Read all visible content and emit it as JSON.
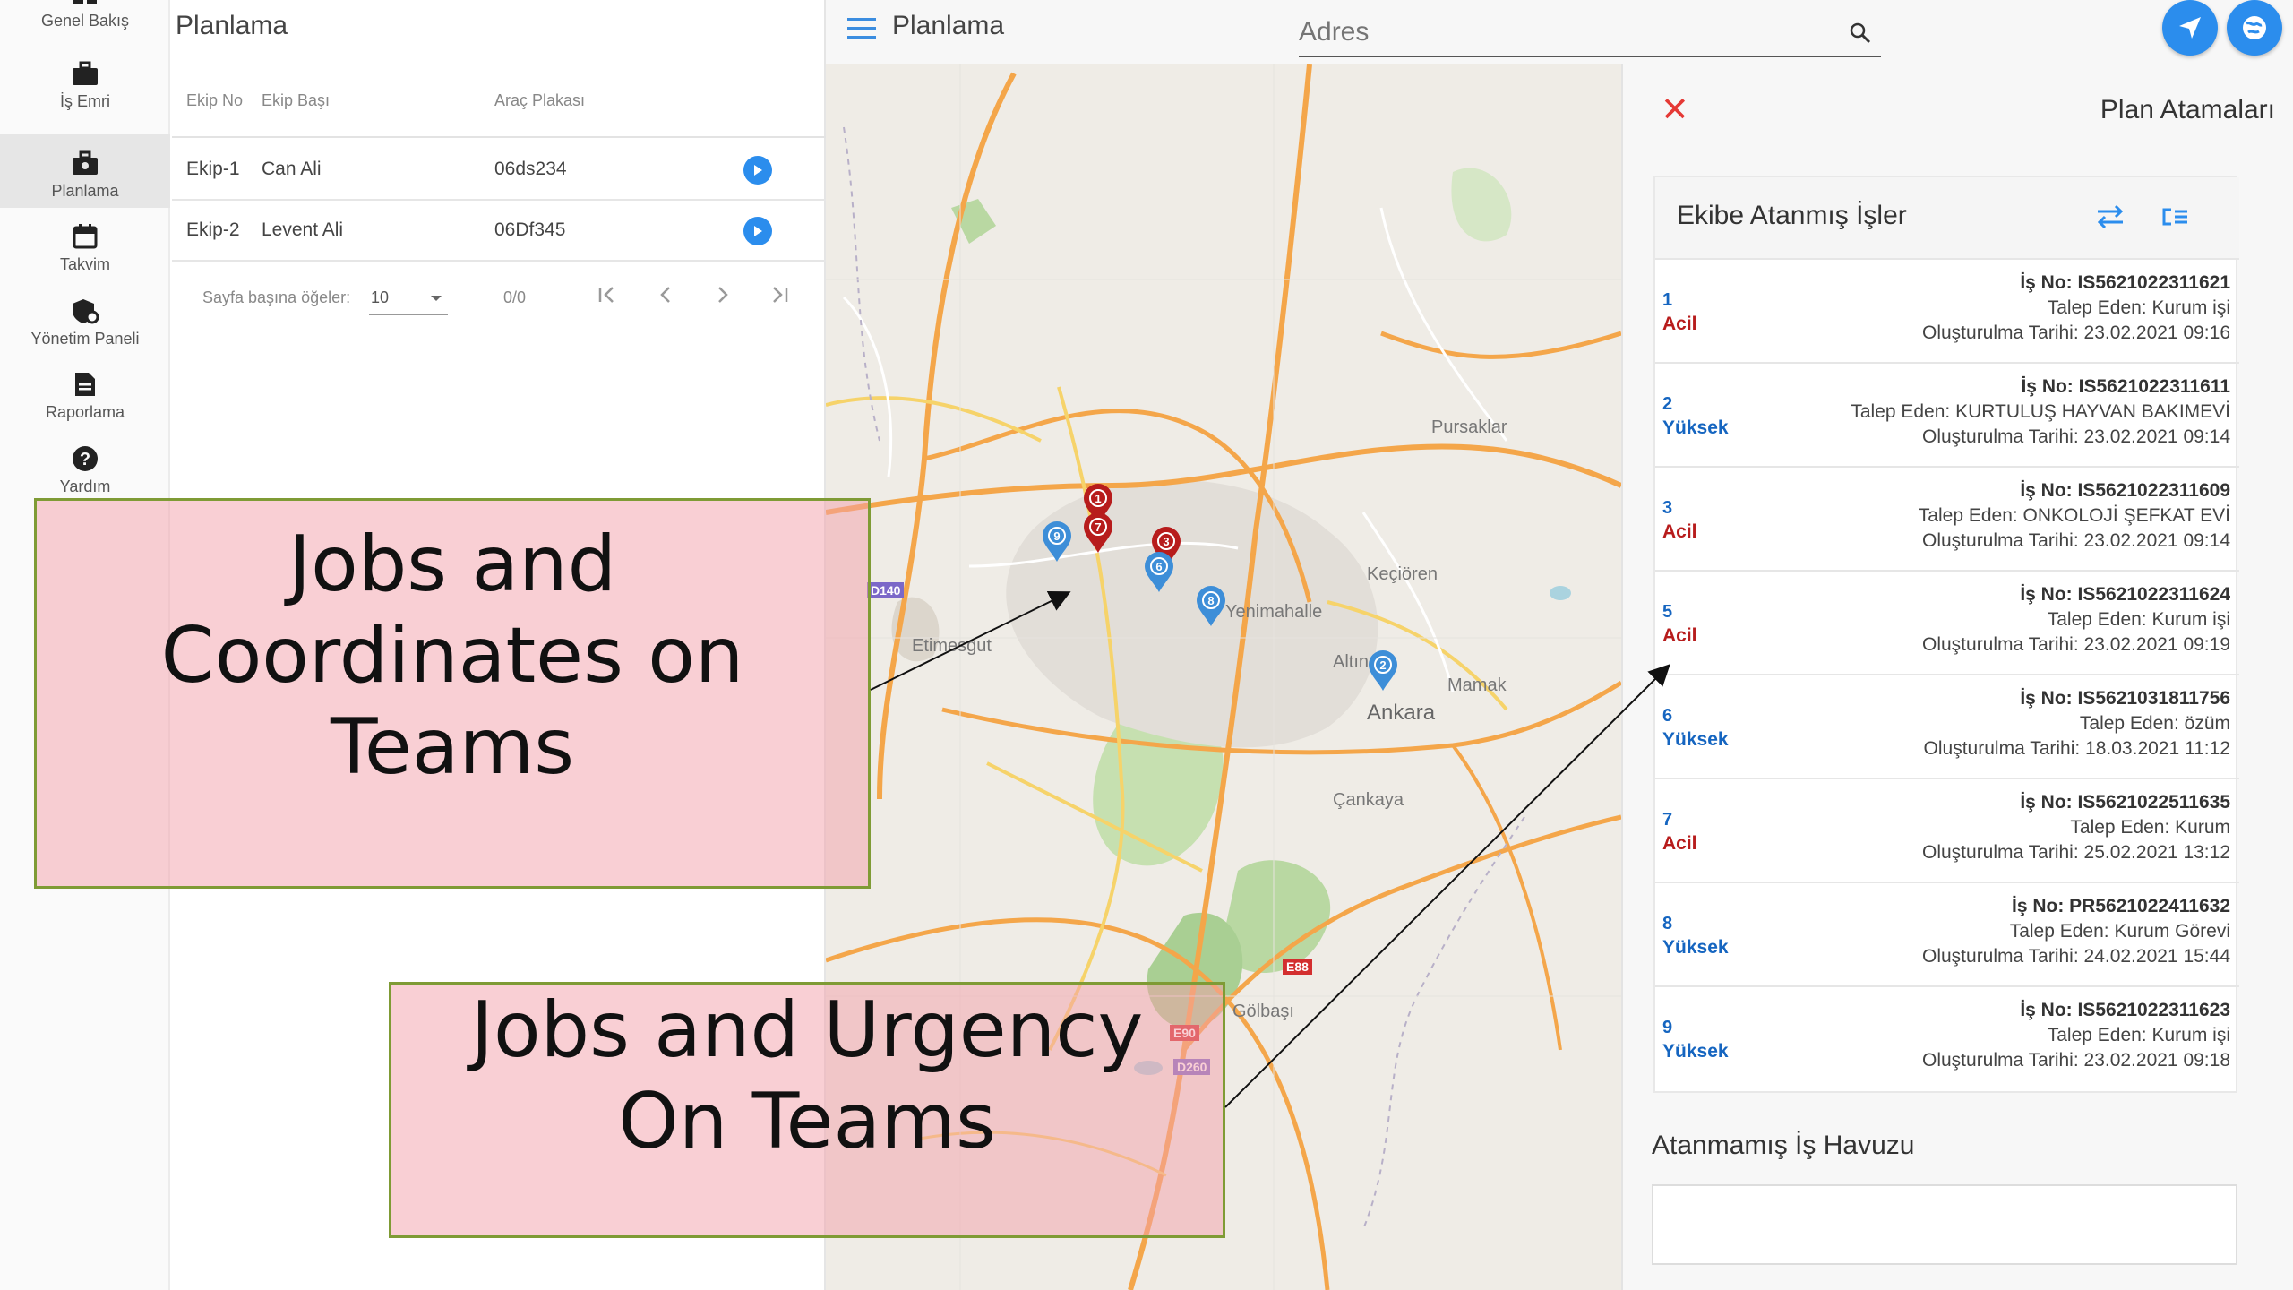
{
  "nav": {
    "items": [
      {
        "label": "Genel Bakış",
        "icon": "dashboard-icon"
      },
      {
        "label": "İş Emri",
        "icon": "briefcase-icon"
      },
      {
        "label": "Planlama",
        "icon": "planning-icon",
        "active": true
      },
      {
        "label": "Takvim",
        "icon": "calendar-icon"
      },
      {
        "label": "Yönetim Paneli",
        "icon": "admin-icon"
      },
      {
        "label": "Raporlama",
        "icon": "report-icon"
      },
      {
        "label": "Yardım",
        "icon": "help-icon"
      }
    ]
  },
  "teams": {
    "title": "Planlama",
    "columns": [
      "Ekip No",
      "Ekip Başı",
      "Araç Plakası"
    ],
    "rows": [
      {
        "no": "Ekip-1",
        "leader": "Can Ali",
        "plate": "06ds234"
      },
      {
        "no": "Ekip-2",
        "leader": "Levent Ali",
        "plate": "06Df345"
      }
    ],
    "pager": {
      "per_page_label": "Sayfa başına öğeler:",
      "per_page": "10",
      "range": "0/0"
    }
  },
  "topbar": {
    "title": "Planlama",
    "search_placeholder": "Adres"
  },
  "map": {
    "places": [
      "Pursaklar",
      "Keçiören",
      "Yenimahalle",
      "Etimesgut",
      "Altın",
      "Mamak",
      "Ankara",
      "Çankaya",
      "Gölbaşı"
    ],
    "road_labels": [
      "D140",
      "E88",
      "E90",
      "D260"
    ],
    "markers": [
      {
        "label": "1",
        "color": "#b71c1c"
      },
      {
        "label": "7",
        "color": "#b71c1c"
      },
      {
        "label": "3",
        "color": "#b71c1c"
      },
      {
        "label": "9",
        "color": "#3d8ed8"
      },
      {
        "label": "6",
        "color": "#3d8ed8"
      },
      {
        "label": "8",
        "color": "#3d8ed8"
      },
      {
        "label": "2",
        "color": "#3d8ed8"
      }
    ]
  },
  "plan": {
    "title": "Plan Atamaları",
    "card_title": "Ekibe Atanmış İşler",
    "jobs": [
      {
        "num": "1",
        "urgency": "Acil",
        "no": "İş No: IS5621022311621",
        "by": "Talep Eden: Kurum işi",
        "date": "Oluşturulma Tarihi: 23.02.2021 09:16"
      },
      {
        "num": "2",
        "urgency": "Yüksek",
        "no": "İş No: IS5621022311611",
        "by": "Talep Eden: KURTULUŞ HAYVAN BAKIMEVİ",
        "date": "Oluşturulma Tarihi: 23.02.2021 09:14"
      },
      {
        "num": "3",
        "urgency": "Acil",
        "no": "İş No: IS5621022311609",
        "by": "Talep Eden: ONKOLOJİ ŞEFKAT EVİ",
        "date": "Oluşturulma Tarihi: 23.02.2021 09:14"
      },
      {
        "num": "5",
        "urgency": "Acil",
        "no": "İş No: IS5621022311624",
        "by": "Talep Eden: Kurum işi",
        "date": "Oluşturulma Tarihi: 23.02.2021 09:19"
      },
      {
        "num": "6",
        "urgency": "Yüksek",
        "no": "İş No: IS5621031811756",
        "by": "Talep Eden: özüm",
        "date": "Oluşturulma Tarihi: 18.03.2021 11:12"
      },
      {
        "num": "7",
        "urgency": "Acil",
        "no": "İş No: IS5621022511635",
        "by": "Talep Eden: Kurum",
        "date": "Oluşturulma Tarihi: 25.02.2021 13:12"
      },
      {
        "num": "8",
        "urgency": "Yüksek",
        "no": "İş No: PR5621022411632",
        "by": "Talep Eden: Kurum Görevi",
        "date": "Oluşturulma Tarihi: 24.02.2021 15:44"
      },
      {
        "num": "9",
        "urgency": "Yüksek",
        "no": "İş No: IS5621022311623",
        "by": "Talep Eden: Kurum işi",
        "date": "Oluşturulma Tarihi: 23.02.2021 09:18"
      }
    ],
    "pool_title": "Atanmamış İş Havuzu"
  },
  "annotations": {
    "coords": "Jobs and Coordinates on Teams",
    "urgency": "Jobs and Urgency On Teams"
  },
  "colors": {
    "accent": "#2b8ded",
    "urgent": "#b71c1c",
    "high": "#1565c0",
    "callout_fill": "#f4a0aa",
    "callout_border": "#7f9b35"
  }
}
